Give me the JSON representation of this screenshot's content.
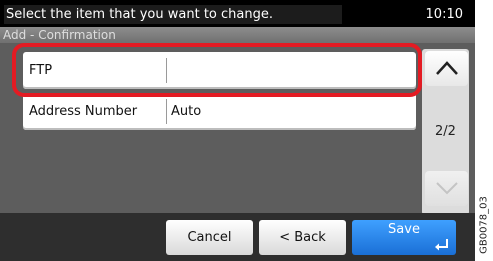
{
  "header": {
    "message": "Select the item that you want to change.",
    "time": "10:10"
  },
  "title": "Add - Confirmation",
  "rows": [
    {
      "label": "FTP",
      "value": ""
    },
    {
      "label": "Address Number",
      "value": "Auto"
    }
  ],
  "scroll": {
    "page": "2/2",
    "up_icon": "chevron-up-icon",
    "down_icon": "chevron-down-icon"
  },
  "buttons": {
    "cancel": "Cancel",
    "back": "< Back",
    "save": "Save"
  },
  "image_code": "GB0078_03",
  "colors": {
    "highlight": "#e31b23",
    "save": "#2a86ee"
  }
}
